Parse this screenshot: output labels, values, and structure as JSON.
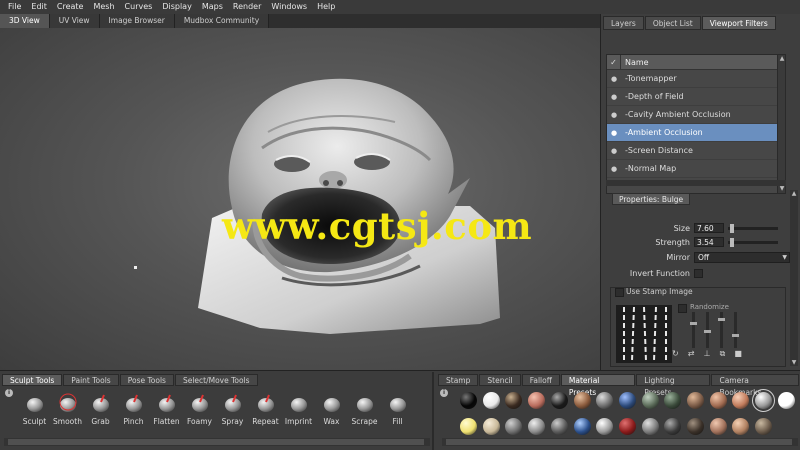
{
  "menu": [
    "File",
    "Edit",
    "Create",
    "Mesh",
    "Curves",
    "Display",
    "Maps",
    "Render",
    "Windows",
    "Help"
  ],
  "viewport_tabs": [
    {
      "label": "3D View",
      "active": true
    },
    {
      "label": "UV View",
      "active": false
    },
    {
      "label": "Image Browser",
      "active": false
    },
    {
      "label": "Mudbox Community",
      "active": false
    }
  ],
  "watermark": "www.cgtsj.com",
  "right_tabs": [
    {
      "label": "Layers",
      "active": false
    },
    {
      "label": "Object List",
      "active": false
    },
    {
      "label": "Viewport Filters",
      "active": true
    }
  ],
  "filters": {
    "header": "Name",
    "items": [
      {
        "label": "-Tonemapper",
        "selected": false
      },
      {
        "label": "-Depth of Field",
        "selected": false
      },
      {
        "label": "-Cavity Ambient Occlusion",
        "selected": false
      },
      {
        "label": "-Ambient Occlusion",
        "selected": true
      },
      {
        "label": "-Screen Distance",
        "selected": false
      },
      {
        "label": "-Normal Map",
        "selected": false
      }
    ]
  },
  "properties": {
    "title": "Properties: Bulge",
    "size_label": "Size",
    "size_value": "7.60",
    "size_level": 0.05,
    "strength_label": "Strength",
    "strength_value": "3.54",
    "strength_level": 0.04,
    "mirror_label": "Mirror",
    "mirror_value": "Off",
    "invert_label": "Invert Function",
    "stamp_label": "Use Stamp Image",
    "falloff_label": "Randomize"
  },
  "tray_tabs_left": [
    {
      "label": "Sculpt Tools",
      "active": true
    },
    {
      "label": "Paint Tools",
      "active": false
    },
    {
      "label": "Pose Tools",
      "active": false
    },
    {
      "label": "Select/Move Tools",
      "active": false
    }
  ],
  "tools": [
    {
      "label": "Sculpt",
      "icon": "sculpt-icon"
    },
    {
      "label": "Smooth",
      "icon": "smooth-icon"
    },
    {
      "label": "Grab",
      "icon": "grab-icon"
    },
    {
      "label": "Pinch",
      "icon": "pinch-icon"
    },
    {
      "label": "Flatten",
      "icon": "flatten-icon"
    },
    {
      "label": "Foamy",
      "icon": "foamy-icon"
    },
    {
      "label": "Spray",
      "icon": "spray-icon"
    },
    {
      "label": "Repeat",
      "icon": "repeat-icon"
    },
    {
      "label": "Imprint",
      "icon": "imprint-icon"
    },
    {
      "label": "Wax",
      "icon": "wax-icon"
    },
    {
      "label": "Scrape",
      "icon": "scrape-icon"
    },
    {
      "label": "Fill",
      "icon": "fill-icon"
    }
  ],
  "tray_tabs_right": [
    {
      "label": "Stamp",
      "active": false
    },
    {
      "label": "Stencil",
      "active": false
    },
    {
      "label": "Falloff",
      "active": false
    },
    {
      "label": "Material Presets",
      "active": true
    },
    {
      "label": "Lighting Presets",
      "active": false
    },
    {
      "label": "Camera Bookmarks",
      "active": false
    }
  ],
  "materials": [
    {
      "color": "#050505",
      "hl": "#777"
    },
    {
      "color": "#e8e8e8",
      "hl": "#ffffff"
    },
    {
      "color": "#3a2a20",
      "hl": "#c8b090"
    },
    {
      "color": "#b86b5c",
      "hl": "#f5c2b0"
    },
    {
      "color": "#1a1a1a",
      "hl": "#aaaaaa"
    },
    {
      "color": "#8a5a3c",
      "hl": "#e6c0a0"
    },
    {
      "color": "#6e6e6e",
      "hl": "#dddddd"
    },
    {
      "color": "#2c4a7a",
      "hl": "#a0c0ff"
    },
    {
      "color": "#5a6a58",
      "hl": "#c0d0c0"
    },
    {
      "color": "#3a4a3a",
      "hl": "#9ab09a"
    },
    {
      "color": "#7a5a46",
      "hl": "#e0b898"
    },
    {
      "color": "#a06a50",
      "hl": "#f0c4a8"
    },
    {
      "color": "#c07a5a",
      "hl": "#f8d0b8"
    },
    {
      "color": "#9a9a9a",
      "hl": "#ffffff"
    },
    {
      "color": "#ffffff",
      "hl": "#ffffff"
    },
    {
      "color": "#efe070",
      "hl": "#fffbd0"
    },
    {
      "color": "#c8b898",
      "hl": "#f6ecd8"
    },
    {
      "color": "#6e6e6e",
      "hl": "#cfcfcf"
    },
    {
      "color": "#8a8a8a",
      "hl": "#eeeeee"
    },
    {
      "color": "#5a5a5a",
      "hl": "#cccccc"
    },
    {
      "color": "#2a4e8a",
      "hl": "#b0d0ff"
    },
    {
      "color": "#9a9a9a",
      "hl": "#ffffff"
    },
    {
      "color": "#8a1a1a",
      "hl": "#e07070"
    },
    {
      "color": "#7a7a7a",
      "hl": "#e0e0e0"
    },
    {
      "color": "#3a3a3a",
      "hl": "#aaaaaa"
    },
    {
      "color": "#3a3028",
      "hl": "#a09080"
    },
    {
      "color": "#a0705a",
      "hl": "#f0c8b0"
    },
    {
      "color": "#b08060",
      "hl": "#f4d0b4"
    },
    {
      "color": "#6a5a4a",
      "hl": "#c8b8a0"
    }
  ],
  "colors": {
    "accent": "#6a8fbf",
    "watermark": "#f5e814"
  }
}
